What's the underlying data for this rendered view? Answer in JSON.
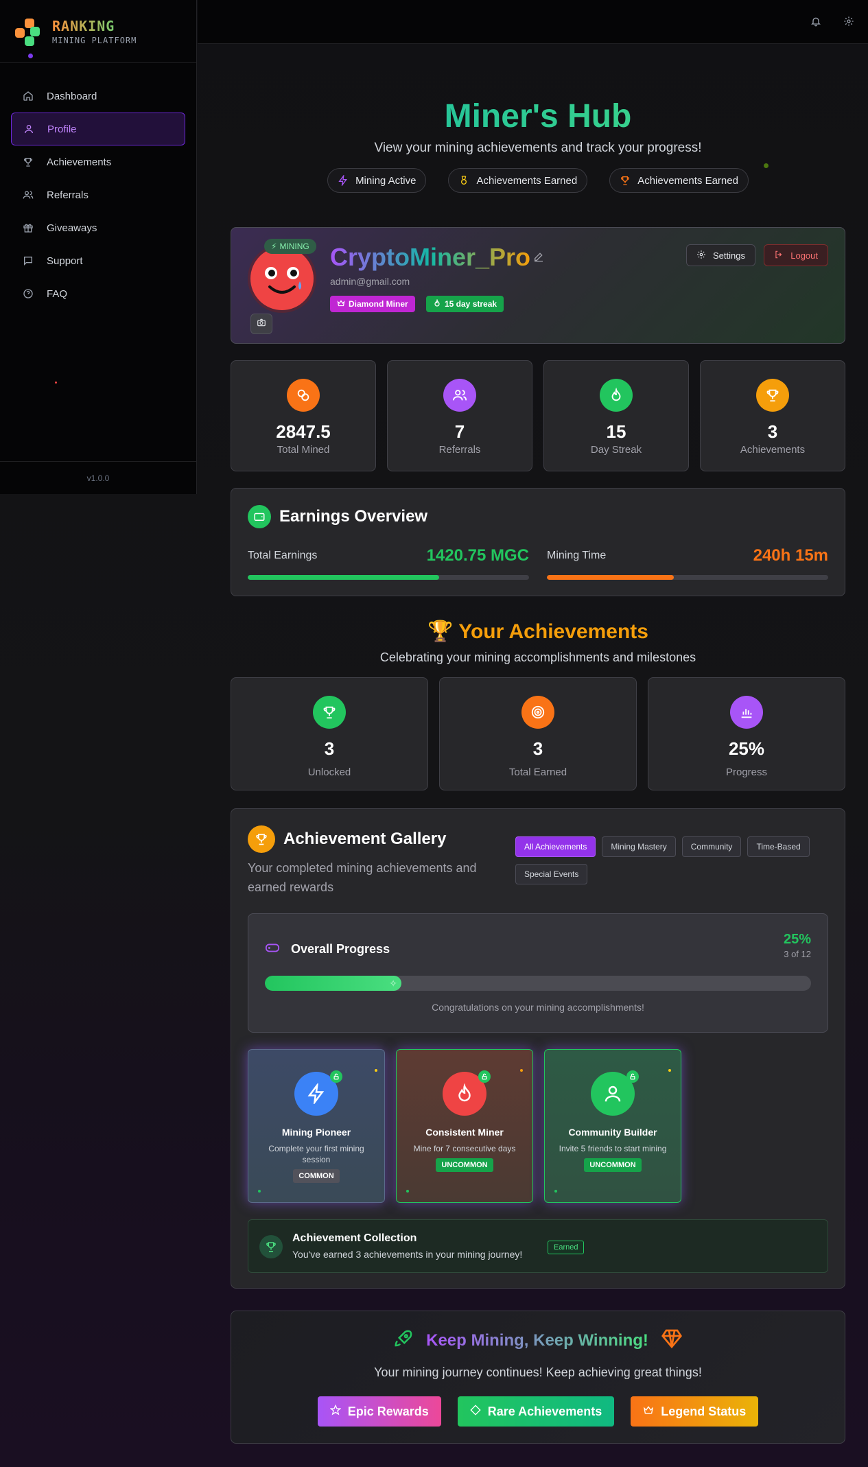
{
  "brand": {
    "title": "RANKING",
    "subtitle": "MINING PLATFORM"
  },
  "sidebar": {
    "items": [
      {
        "label": "Dashboard",
        "icon": "home-icon"
      },
      {
        "label": "Profile",
        "icon": "user-icon",
        "active": true
      },
      {
        "label": "Achievements",
        "icon": "trophy-icon"
      },
      {
        "label": "Referrals",
        "icon": "users-icon"
      },
      {
        "label": "Giveaways",
        "icon": "gift-icon"
      },
      {
        "label": "Support",
        "icon": "message-icon"
      },
      {
        "label": "FAQ",
        "icon": "help-icon"
      }
    ],
    "version": "v1.0.0"
  },
  "topbar": {
    "icons": [
      "bell-icon",
      "gear-icon"
    ]
  },
  "hero": {
    "title": "Miner's Hub",
    "subtitle": "View your mining achievements and track your progress!",
    "pills": [
      "Mining Active",
      "Achievements Earned",
      "Achievements Earned"
    ]
  },
  "profile": {
    "mining_badge": "MINING",
    "username": "CryptoMiner_Pro",
    "email": "admin@gmail.com",
    "tags": [
      "Diamond Miner",
      "15 day streak"
    ],
    "settings_label": "Settings",
    "logout_label": "Logout"
  },
  "stats": [
    {
      "value": "2847.5",
      "label": "Total Mined",
      "color": "#f97316"
    },
    {
      "value": "7",
      "label": "Referrals",
      "color": "#a855f7"
    },
    {
      "value": "15",
      "label": "Day Streak",
      "color": "#22c55e"
    },
    {
      "value": "3",
      "label": "Achievements",
      "color": "#f59e0b"
    }
  ],
  "earnings": {
    "title": "Earnings Overview",
    "total_label": "Total Earnings",
    "total_value": "1420.75 MGC",
    "total_progress": 0.68,
    "time_label": "Mining Time",
    "time_value": "240h 15m",
    "time_progress": 0.45
  },
  "achievements": {
    "title": "Your Achievements",
    "subtitle": "Celebrating your mining accomplishments and milestones",
    "stats": [
      {
        "value": "3",
        "label": "Unlocked",
        "color": "#22c55e"
      },
      {
        "value": "3",
        "label": "Total Earned",
        "color": "#f97316"
      },
      {
        "value": "25%",
        "label": "Progress",
        "color": "#a855f7"
      }
    ]
  },
  "gallery": {
    "title": "Achievement Gallery",
    "subtitle": "Your completed mining achievements and earned rewards",
    "filters": [
      "All Achievements",
      "Mining Mastery",
      "Community",
      "Time-Based",
      "Special Events"
    ],
    "overall": {
      "title": "Overall Progress",
      "percent": "25%",
      "count": "3 of 12",
      "progress": 0.25,
      "message": "Congratulations on your mining accomplishments!"
    },
    "cards": [
      {
        "name": "Mining Pioneer",
        "desc": "Complete your first mining session",
        "rarity": "COMMON",
        "icon": "lightning-icon"
      },
      {
        "name": "Consistent Miner",
        "desc": "Mine for 7 consecutive days",
        "rarity": "UNCOMMON",
        "icon": "flame-icon"
      },
      {
        "name": "Community Builder",
        "desc": "Invite 5 friends to start mining",
        "rarity": "UNCOMMON",
        "icon": "user-icon"
      }
    ],
    "collection": {
      "title": "Achievement Collection",
      "subtitle": "You've earned 3 achievements in your mining journey!",
      "badge": "Earned"
    }
  },
  "keep": {
    "title": "Keep Mining, Keep Winning!",
    "subtitle": "Your mining journey continues! Keep achieving great things!",
    "buttons": [
      "Epic Rewards",
      "Rare Achievements",
      "Legend Status"
    ]
  }
}
